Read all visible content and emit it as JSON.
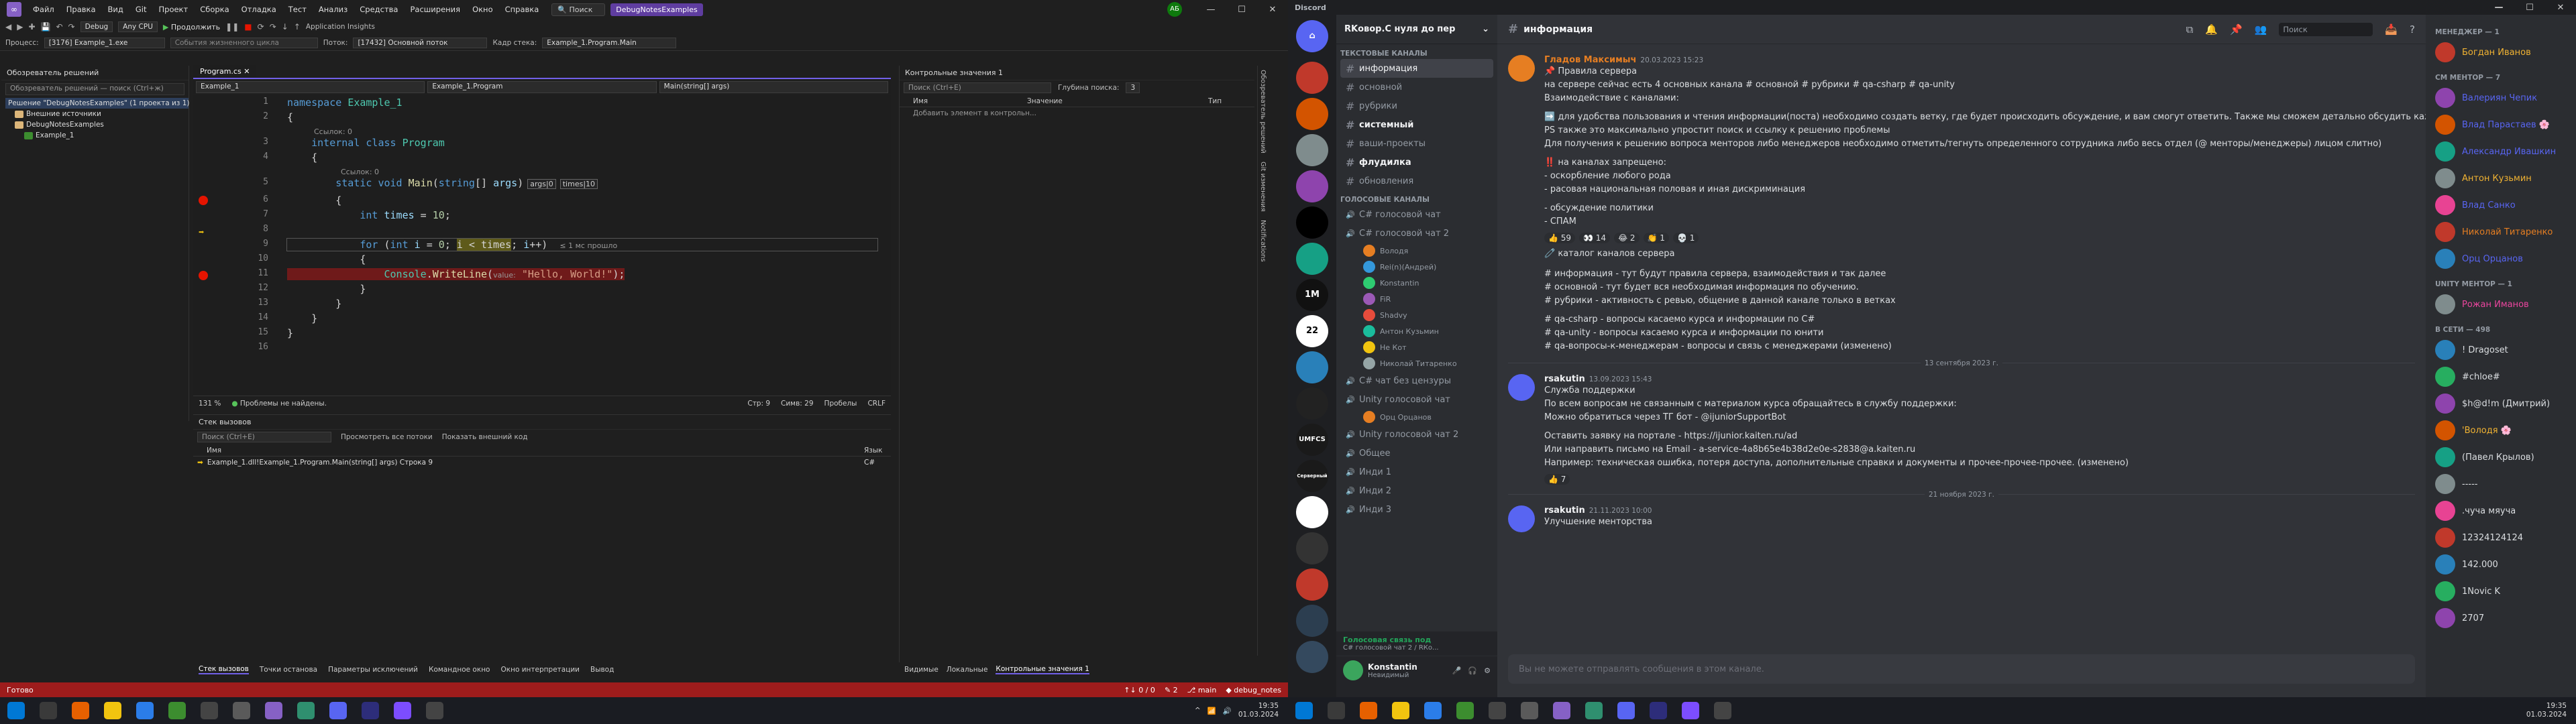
{
  "vs": {
    "menu": [
      "Файл",
      "Правка",
      "Вид",
      "Git",
      "Проект",
      "Сборка",
      "Отладка",
      "Тест",
      "Анализ",
      "Средства",
      "Расширения",
      "Окно",
      "Справка"
    ],
    "search": "Поиск",
    "solution_badge": "DebugNotesExamples",
    "user_initials": "АБ",
    "toolbar1": {
      "debug_config": "Debug",
      "platform": "Any CPU",
      "continue": "Продолжить",
      "app_insights": "Application Insights"
    },
    "toolbar2": {
      "process_label": "Процесс:",
      "process": "[3176] Example_1.exe",
      "lifecycle": "События жизненного цикла",
      "thread_label": "Поток:",
      "thread": "[17432] Основной поток",
      "stack_label": "Кадр стека:",
      "stack_frame": "Example_1.Program.Main"
    },
    "solution_explorer": {
      "title": "Обозреватель решений",
      "search": "Обозреватель решений — поиск (Ctrl+ж)",
      "items": [
        {
          "label": "Решение \"DebugNotesExamples\" (1 проекта из 1)",
          "indent": 0,
          "icon": "solution"
        },
        {
          "label": "Внешние источники",
          "indent": 1,
          "icon": "folder"
        },
        {
          "label": "DebugNotesExamples",
          "indent": 1,
          "icon": "folder"
        },
        {
          "label": "Example_1",
          "indent": 2,
          "icon": "project"
        }
      ]
    },
    "editor": {
      "tab_active": "Program.cs",
      "nav_project": "Example_1",
      "nav_class": "Example_1.Program",
      "nav_member": "Main(string[] args)",
      "refs": "Ссылок: 0",
      "refs2": "Ссылок: 0",
      "hint_args": "args",
      "hint_args_val": "0",
      "hint_times": "times",
      "hint_times_val": "10",
      "elapsed": "≤ 1 мс прошло",
      "value_hint": "value:",
      "status_zoom": "131 %",
      "status_issues": "Проблемы не найдены.",
      "status_line": "Стр: 9",
      "status_col": "Симв: 29",
      "status_ws": "Пробелы",
      "status_eol": "CRLF"
    },
    "watch": {
      "title": "Контрольные значения 1",
      "search": "Поиск (Ctrl+E)",
      "depth_label": "Глубина поиска:",
      "depth": "3",
      "cols": [
        "Имя",
        "Значение",
        "Тип"
      ],
      "add_item": "Добавить элемент в контрольн..."
    },
    "callstack": {
      "title": "Стек вызовов",
      "search": "Поиск (Ctrl+E)",
      "all_threads": "Просмотреть все потоки",
      "external": "Показать внешний код",
      "cols": [
        "Имя",
        "Язык"
      ],
      "frame": "Example_1.dll!Example_1.Program.Main(string[] args) Строка 9",
      "frame_lang": "C#"
    },
    "bottom_tabs": [
      "Стек вызовов",
      "Точки останова",
      "Параметры исключений",
      "Командное окно",
      "Окно интерпретации",
      "Вывод"
    ],
    "bottom_tabs2": [
      "Видимые",
      "Локальные",
      "Контрольные значения 1"
    ],
    "vtabs": [
      "Обозреватель решений",
      "Git изменения",
      "Notifications"
    ],
    "status": {
      "left": "Готово",
      "errors": "0 / 0",
      "commits": "2",
      "branch": "main",
      "repo": "debug_notes"
    }
  },
  "discord": {
    "app": "Discord",
    "server": "RKовор.С нуля до пер",
    "guilds": [
      "1M",
      "22",
      "UMFCS",
      "Серверный"
    ],
    "categories": {
      "text": "Текстовые каналы",
      "voice": "Голосовые каналы"
    },
    "text_channels": [
      {
        "name": "информация",
        "active": true
      },
      {
        "name": "основной"
      },
      {
        "name": "рубрики"
      },
      {
        "name": "системный",
        "unread": true
      },
      {
        "name": "ваши-проекты"
      },
      {
        "name": "флудилка",
        "unread": true
      },
      {
        "name": "обновления"
      }
    ],
    "voice_channels": [
      {
        "name": "C# голосовой чат"
      },
      {
        "name": "C# голосовой чат 2",
        "users": [
          "Володя",
          "Rei(n)(Андрей)",
          "Konstantin",
          "FiR",
          "Shadvy",
          "Антон Кузьмин",
          "Не Кот",
          "Николай Титаренко"
        ]
      },
      {
        "name": "C# чат без цензуры"
      },
      {
        "name": "Unity голосовой чат",
        "users": [
          "Орц Орцанов"
        ]
      },
      {
        "name": "Unity голосовой чат 2"
      },
      {
        "name": "Общее"
      },
      {
        "name": "Инди 1"
      },
      {
        "name": "Инди 2"
      },
      {
        "name": "Инди 3"
      }
    ],
    "voice_status": "Голосовая связь под",
    "voice_sub": "C# голосовой чат 2 / RКо...",
    "user_name": "Konstantin",
    "user_status": "Невидимый",
    "channel_title": "информация",
    "header_search": "Поиск",
    "msg1": {
      "author": "Гладов Максимыч",
      "time": "20.03.2023 15:23",
      "lines": [
        "📌 Правила сервера",
        "на сервере сейчас есть 4 основных каналa # основной # рубрики # qa-csharp # qa-unity",
        "Взаимодействие с каналами:",
        "➡️ для удобства пользования и чтения информации(поста) необходимо создать ветку, где будет происходить обсуждение, и вам смогут ответить. Также мы сможем детально обсудить каждый взятый пост, не теряясь в потоке других новостей и вопросов",
        "PS также это максимально упростит поиск и ссылку к решению проблемы",
        "Для получения к решению вопроса менторов либо менеджеров необходимо отметить/тегнуть определенного сотрудника либо весь отдел (@ менторы/менеджеры) лицом слитно)",
        "‼️ на каналах запрещено:",
        "- оскорбление любого рода",
        "- расовая национальная половая и иная дискриминация",
        "- обсуждение политики",
        "- СПАМ"
      ],
      "reactions": [
        "👍 59",
        "👀 14",
        "😂 2",
        "👏 1",
        "💀 1"
      ],
      "catalog": "🧷 каталог каналов сервера",
      "catalog_lines": [
        "# информация - тут будут правила сервера, взаимодействия и так далее",
        "# основной - тут будет вся необходимая информация по обучению.",
        "# рубрики - активность с ревью, общение в данной канале только в ветках",
        "# qa-csharp - вопросы касаемо курса и информации по С#",
        "# qa-unity - вопросы касаемо курса и информации по юнити",
        "# qa-вопросы-к-менеджерам - вопросы и связь с менеджерами (изменено)"
      ]
    },
    "date1": "13 сентября 2023 г.",
    "msg2": {
      "author": "rsakutin",
      "time": "13.09.2023 15:43",
      "lines": [
        "Служба поддержки",
        "По всем вопросам не связанным с материалом курса обращайтесь в службу поддержки:",
        "Можно обратиться через ТГ бот - @ijuniorSupportBot",
        "Оставить заявку на портале - https://ijunior.kaiten.ru/ad",
        "Или направить письмо на Email - a-service-4a8b65e4b38d2e0e-s2838@a.kaiten.ru",
        "Например: техническая ошибка, потеря доступа, дополнительные справки и документы и прочее-прочее-прочее. (изменено)"
      ],
      "reactions": [
        "👍 7"
      ]
    },
    "date2": "21 ноября 2023 г.",
    "msg3": {
      "author": "rsakutin",
      "time": "21.11.2023 10:00",
      "lines": [
        "Улучшение менторства"
      ]
    },
    "composer": "Вы не можете отправлять сообщения в этом канале.",
    "members": [
      {
        "cat": "Менеджер — 1",
        "items": [
          {
            "name": "Богдан Иванов",
            "color": "#f0b232"
          }
        ]
      },
      {
        "cat": "СМ ментор — 7",
        "items": [
          {
            "name": "Валериян Чепик",
            "color": "#5865f2"
          },
          {
            "name": "Влад Парастаев 🌸",
            "color": "#5865f2"
          },
          {
            "name": "Александр Ивашкин",
            "color": "#5865f2"
          },
          {
            "name": "Антон Кузьмин",
            "color": "#f0b232"
          },
          {
            "name": "Влад Санкo",
            "color": "#5865f2"
          },
          {
            "name": "Николай Титаренко",
            "color": "#e67e22"
          },
          {
            "name": "Орц Орцанов",
            "color": "#5865f2"
          }
        ]
      },
      {
        "cat": "Unity ментор — 1",
        "items": [
          {
            "name": "Рожан Иманов",
            "color": "#eb459e"
          }
        ]
      },
      {
        "cat": "В сети — 498",
        "items": [
          {
            "name": "! Dragoset",
            "color": "#dbdee1"
          },
          {
            "name": "#chloe#",
            "color": "#dbdee1"
          },
          {
            "name": "$h@d!m (Дмитрий)",
            "color": "#dbdee1"
          },
          {
            "name": "'Володя 🌸",
            "color": "#f0b232"
          },
          {
            "name": "(Павел Крылов)",
            "color": "#dbdee1"
          },
          {
            "name": "-----",
            "color": "#dbdee1"
          },
          {
            "name": ".чуча мяуча",
            "color": "#dbdee1"
          },
          {
            "name": "12324124124",
            "color": "#dbdee1"
          },
          {
            "name": "142.000",
            "color": "#dbdee1"
          },
          {
            "name": "1Novic K",
            "color": "#dbdee1"
          },
          {
            "name": "2707",
            "color": "#dbdee1"
          }
        ]
      }
    ]
  },
  "clock": {
    "time": "19:35",
    "date": "01.03.2024"
  },
  "clock2": {
    "time": "19:35",
    "date": "01.03.2024"
  }
}
